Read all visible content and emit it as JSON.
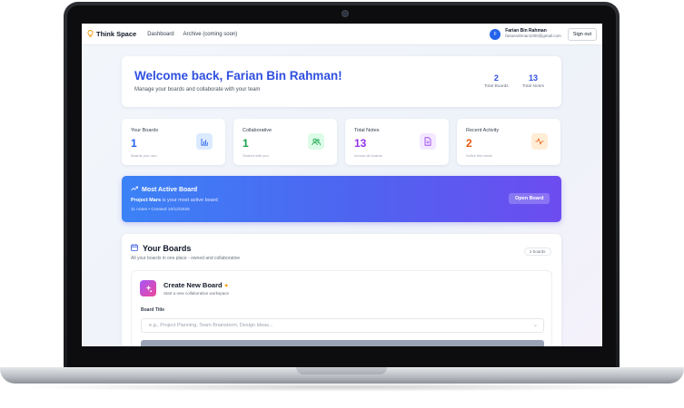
{
  "app": {
    "name": "Think Space"
  },
  "nav": {
    "dashboard": "Dashboard",
    "archive": "Archive (coming soon)"
  },
  "user": {
    "initial": "F",
    "name": "Farian Bin Rahman",
    "email": "farianrahman1000@gmail.com",
    "signout": "Sign out"
  },
  "welcome": {
    "title": "Welcome back, Farian Bin Rahman!",
    "subtitle": "Manage your boards and collaborate with your team",
    "stats": [
      {
        "value": "2",
        "label": "Total Boards"
      },
      {
        "value": "13",
        "label": "Total Notes"
      }
    ]
  },
  "cards": [
    {
      "label": "Your Boards",
      "value": "1",
      "sub": "Boards you own",
      "icon": "chart-icon",
      "color": "#2563eb"
    },
    {
      "label": "Collaborative",
      "value": "1",
      "sub": "Shared with you",
      "icon": "users-icon",
      "color": "#16a34a"
    },
    {
      "label": "Total Notes",
      "value": "13",
      "sub": "Across all boards",
      "icon": "document-icon",
      "color": "#9333ea"
    },
    {
      "label": "Recent Activity",
      "value": "2",
      "sub": "Active this week",
      "icon": "activity-icon",
      "color": "#ea580c"
    }
  ],
  "most_active": {
    "title": "Most Active Board",
    "board": "Project Mars",
    "desc": " is your most active board",
    "meta": "11 notes • Created 10/12/2025",
    "button": "Open Board"
  },
  "boards": {
    "title": "Your Boards",
    "subtitle": "All your boards in one place - owned and collaborative",
    "count": "2 boards",
    "create": {
      "title": "Create New Board",
      "subtitle": "Start a new collaborative workspace",
      "field_label": "Board Title",
      "placeholder": "e.g., Project Planning, Team Brainstorm, Design Ideas..."
    }
  }
}
